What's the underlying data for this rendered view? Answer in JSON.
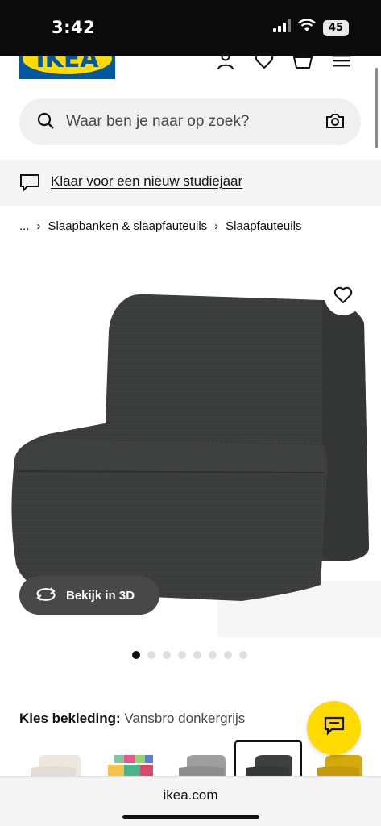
{
  "status_bar": {
    "time": "3:42",
    "battery": "45",
    "icons": [
      "signal-icon",
      "wifi-icon",
      "battery-icon"
    ]
  },
  "header": {
    "logo_text": "IKEA",
    "icons": [
      "account-icon",
      "heart-icon",
      "basket-icon",
      "menu-icon"
    ]
  },
  "search": {
    "placeholder": "Waar ben je naar op zoek?"
  },
  "banner": {
    "link_text": "Klaar voor een nieuw studiejaar"
  },
  "breadcrumb": {
    "items": [
      "...",
      "Slaapbanken & slaapfauteuils",
      "Slaapfauteuils"
    ]
  },
  "product": {
    "view_3d_label": "Bekijk in 3D",
    "image_count": 8,
    "active_image": 1
  },
  "cover": {
    "label": "Kies bekleding:",
    "value": "Vansbro donkergrijs",
    "swatches": [
      {
        "color": "#ece7df",
        "selected": false
      },
      {
        "color": "#7fc6a4",
        "selected": false
      },
      {
        "color": "#9e9e9e",
        "selected": false
      },
      {
        "color": "#3e3f3f",
        "selected": true
      },
      {
        "color": "#d4a90e",
        "selected": false
      }
    ]
  },
  "browser": {
    "url": "ikea.com"
  },
  "colors": {
    "ikea_blue": "#0058a3",
    "ikea_yellow": "#ffdb00",
    "chair": "#3b3c3c"
  }
}
